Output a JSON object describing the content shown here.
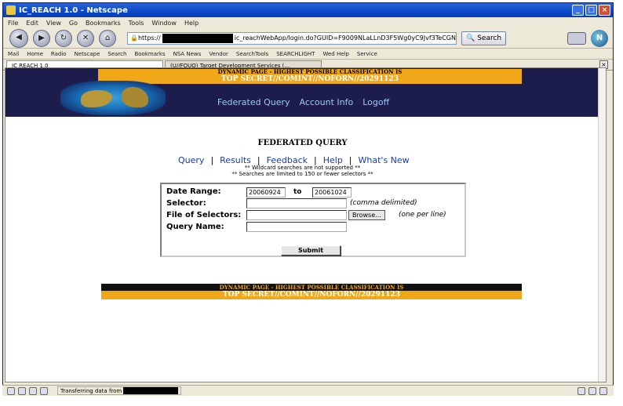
{
  "window": {
    "title": "IC_REACH 1.0 - Netscape",
    "controls": [
      "_",
      "□",
      "×"
    ]
  },
  "menubar": [
    "File",
    "Edit",
    "View",
    "Go",
    "Bookmarks",
    "Tools",
    "Window",
    "Help"
  ],
  "navbar": {
    "url_prefix": "https://",
    "url_suffix": "ic_reachWebApp/login.do?GUID=F9009NLaLLnD3F5Wg0yC9Jvf3TeCGN",
    "search_label": "Search"
  },
  "bookmarks": [
    "Mail",
    "Home",
    "Radio",
    "Netscape",
    "Search",
    "Bookmarks",
    "NSA News",
    "Vendor",
    "SearchTools",
    "SEARCHLIGHT",
    "Wed Help",
    "Service"
  ],
  "tabs": [
    {
      "label": "IC REACH 1.0"
    },
    {
      "label": "(U//FOUO) Target Development Services (..."
    }
  ],
  "classification": {
    "line1": "DYNAMIC PAGE - HIGHEST POSSIBLE CLASSIFICATION IS",
    "line2": "TOP SECRET//COMINT//NOFORN//20291123",
    "footer_line1": "DYNAMIC PAGE - HIGHEST POSSIBLE CLASSIFICATION IS",
    "footer_line2": "TOP SECRET//COMINT//NOFORN//20291123"
  },
  "header_nav": [
    "Federated Query",
    "Account Info",
    "Logoff"
  ],
  "page": {
    "title": "FEDERATED QUERY",
    "links": [
      "Query",
      "Results",
      "Feedback",
      "Help",
      "What's New"
    ],
    "separator": "|",
    "notes": [
      "** Wildcard searches are not supported **",
      "** Searches are limited to 150 or fewer selectors **"
    ]
  },
  "form": {
    "date_range_label": "Date Range:",
    "date_from": "20060924",
    "to_label": "to",
    "date_to": "20061024",
    "selector_label": "Selector:",
    "selector_hint": "(comma delimited)",
    "file_label": "File of Selectors:",
    "browse_label": "Browse...",
    "file_hint": "(one per line)",
    "query_name_label": "Query Name:",
    "submit_label": "Submit"
  },
  "status": {
    "text": "Transferring data from"
  }
}
